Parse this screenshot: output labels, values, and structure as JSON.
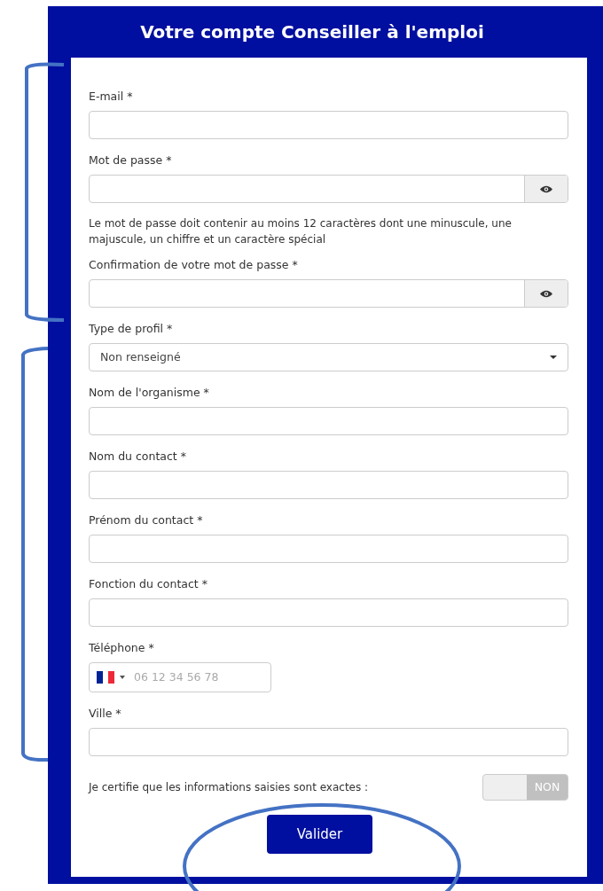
{
  "header": {
    "title": "Votre compte Conseiller à l'emploi"
  },
  "fields": [
    {
      "kind": "text",
      "label": "E-mail *"
    },
    {
      "kind": "password",
      "label": "Mot de passe *",
      "hint": "Le mot de passe doit contenir au moins 12 caractères dont une minuscule, une majuscule, un chiffre et un caractère spécial"
    },
    {
      "kind": "password",
      "label": "Confirmation de votre mot de passe *"
    },
    {
      "kind": "select",
      "label": "Type de profil *",
      "value": "Non renseigné"
    },
    {
      "kind": "text",
      "label": "Nom de l'organisme *"
    },
    {
      "kind": "text",
      "label": "Nom du contact *"
    },
    {
      "kind": "text",
      "label": "Prénom du contact *"
    },
    {
      "kind": "text",
      "label": "Fonction du contact *"
    },
    {
      "kind": "phone",
      "label": "Téléphone *",
      "placeholder": "06 12 34 56 78"
    },
    {
      "kind": "text",
      "label": "Ville *"
    }
  ],
  "certification": {
    "label": "Je certifie que les informations saisies sont exactes :",
    "on": false,
    "toggle_text": "NON"
  },
  "submit": {
    "label": "Valider"
  }
}
